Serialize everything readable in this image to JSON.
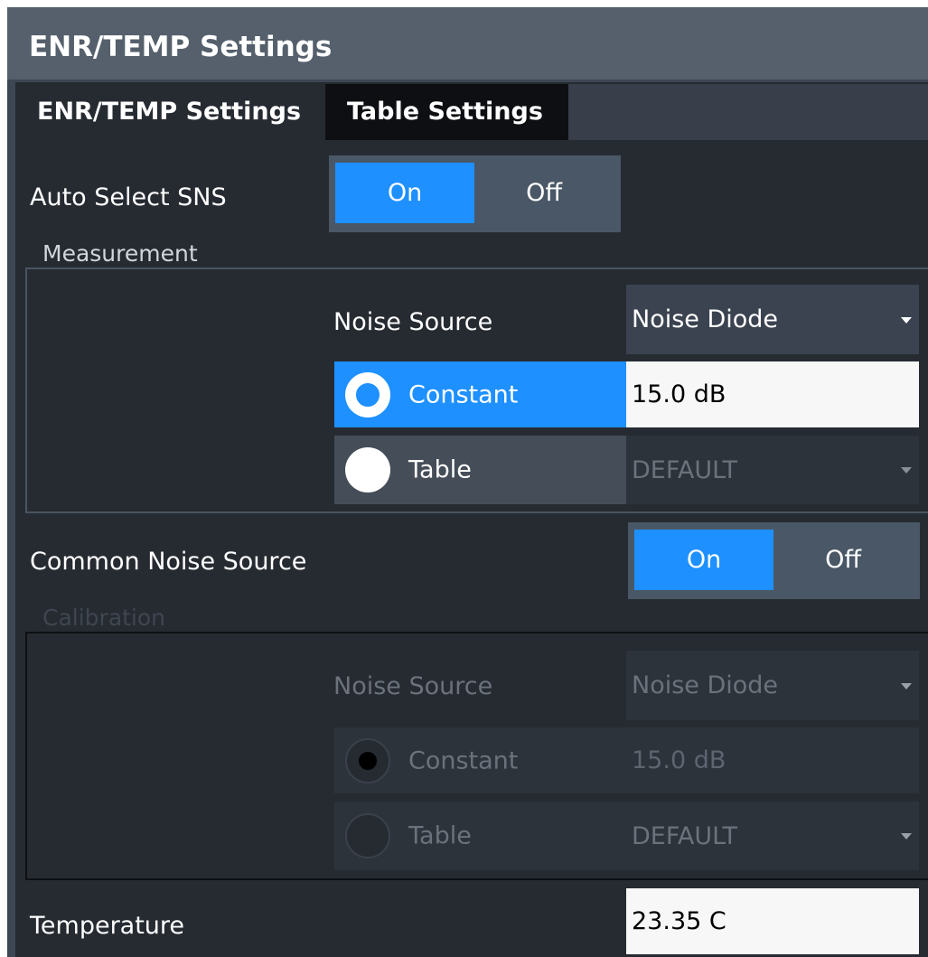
{
  "dialog": {
    "title": "ENR/TEMP Settings"
  },
  "tabs": [
    {
      "label": "ENR/TEMP Settings",
      "active": true
    },
    {
      "label": "Table Settings",
      "active": false
    }
  ],
  "auto_select_sns": {
    "label": "Auto Select SNS",
    "on": "On",
    "off": "Off",
    "selected": "On"
  },
  "measurement": {
    "title": "Measurement",
    "noise_source_label": "Noise Source",
    "noise_source_value": "Noise Diode",
    "constant_label": "Constant",
    "constant_value": "15.0 dB",
    "table_label": "Table",
    "table_value": "DEFAULT",
    "selected": "Constant"
  },
  "common_noise_source": {
    "label": "Common Noise Source",
    "on": "On",
    "off": "Off",
    "selected": "On"
  },
  "calibration": {
    "title": "Calibration",
    "noise_source_label": "Noise Source",
    "noise_source_value": "Noise Diode",
    "constant_label": "Constant",
    "constant_value": "15.0 dB",
    "table_label": "Table",
    "table_value": "DEFAULT",
    "selected": "Constant"
  },
  "temperature": {
    "label": "Temperature",
    "value": "23.35 C"
  },
  "colors": {
    "accent": "#1e90ff",
    "background": "#262b32",
    "title_bar": "#55606c"
  }
}
